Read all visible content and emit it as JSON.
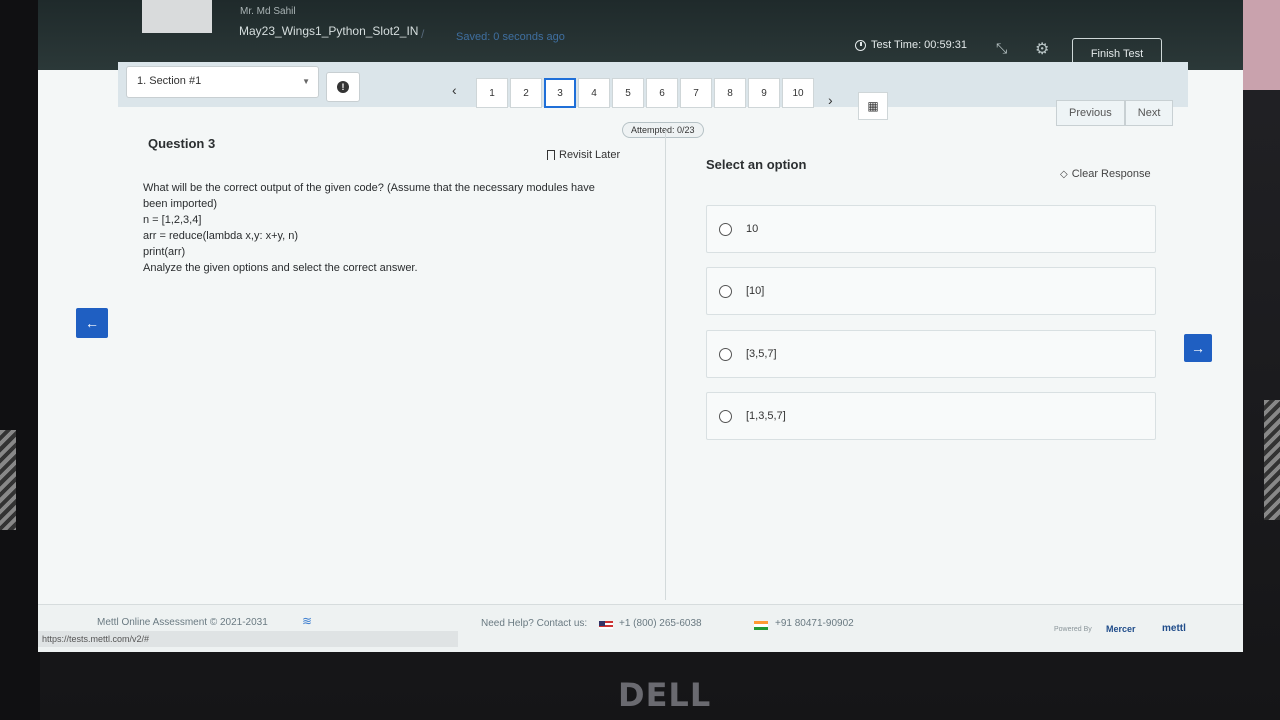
{
  "header": {
    "candidate_name": "Mr. Md Sahil",
    "test_name": "May23_Wings1_Python_Slot2_IN",
    "separator": "/",
    "save_status": "Saved: 0 seconds ago",
    "timer_label": "Test Time: 00:59:31",
    "finish_label": "Finish Test"
  },
  "nav": {
    "section": "1. Section #1",
    "pages": [
      "1",
      "2",
      "3",
      "4",
      "5",
      "6",
      "7",
      "8",
      "9",
      "10"
    ],
    "active_page": "3",
    "attempted": "Attempted: 0/23",
    "previous_label": "Previous",
    "next_label": "Next"
  },
  "question": {
    "title": "Question 3",
    "revisit_label": "Revisit Later",
    "lines": [
      "What will be the correct output of the given code? (Assume that the necessary modules have",
      "been imported)",
      "n = [1,2,3,4]",
      "arr = reduce(lambda x,y: x+y, n)",
      "print(arr)",
      "Analyze the given options and select the correct answer."
    ]
  },
  "options": {
    "title": "Select an option",
    "clear_label": "Clear Response",
    "items": [
      "10",
      "[10]",
      "[3,5,7]",
      "[1,3,5,7]"
    ]
  },
  "footer": {
    "copyright": "Mettl Online Assessment © 2021-2031",
    "url": "https://tests.mettl.com/v2/#",
    "help": "Need Help? Contact us:",
    "phone_us": "+1 (800) 265-6038",
    "phone_in": "+91 80471-90902",
    "powered_by": "Powered By",
    "mercer": "Mercer",
    "mettl": "mettl"
  },
  "brand": {
    "monitor_logo": "DELL"
  },
  "colors": {
    "accent_blue": "#1f5fc2",
    "active_page_border": "#1f6fd8",
    "topbar": "#2b3838"
  }
}
